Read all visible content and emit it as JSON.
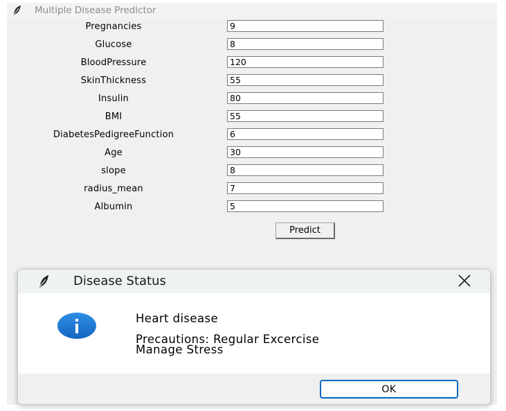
{
  "window": {
    "title": "Multiple Disease Predictor"
  },
  "form": {
    "fields": [
      {
        "label": "Pregnancies",
        "value": "9"
      },
      {
        "label": "Glucose",
        "value": "8"
      },
      {
        "label": "BloodPressure",
        "value": "120"
      },
      {
        "label": "SkinThickness",
        "value": "55"
      },
      {
        "label": "Insulin",
        "value": "80"
      },
      {
        "label": "BMI",
        "value": "55"
      },
      {
        "label": "DiabetesPedigreeFunction",
        "value": "6"
      },
      {
        "label": "Age",
        "value": "30"
      },
      {
        "label": "slope",
        "value": "8"
      },
      {
        "label": "radius_mean",
        "value": "7"
      },
      {
        "label": "Albumin",
        "value": "5"
      }
    ],
    "predict_label": "Predict"
  },
  "dialog": {
    "title": "Disease Status",
    "message_line1": "Heart disease",
    "message_line2": "Precautions: Regular Excercise",
    "message_line3": "Manage Stress",
    "ok_label": "OK",
    "icon": "info-icon",
    "accent_color": "#0067c0",
    "info_color": "#1a78d2"
  }
}
